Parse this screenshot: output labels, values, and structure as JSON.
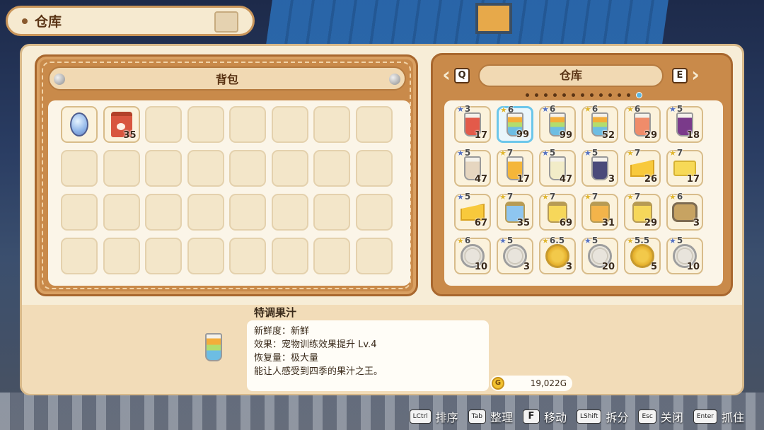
{
  "window": {
    "title": "仓库"
  },
  "backpack": {
    "title": "背包",
    "slots": [
      {
        "icon": "mirror-icon",
        "qty": ""
      },
      {
        "icon": "pet-food-bag-icon",
        "qty": "35"
      },
      {},
      {},
      {},
      {},
      {},
      {},
      {},
      {},
      {},
      {},
      {},
      {},
      {},
      {},
      {},
      {},
      {},
      {},
      {},
      {},
      {},
      {},
      {},
      {},
      {},
      {},
      {},
      {},
      {},
      {}
    ]
  },
  "storage": {
    "title": "仓库",
    "prev_key": "Q",
    "next_key": "E",
    "prev_arrow": "‹",
    "next_arrow": "›",
    "page_count": 13,
    "active_page": 12,
    "items": [
      {
        "icon": "strawberry-juice-icon",
        "stars": "3",
        "star_color": "#5470c0",
        "qty": "17",
        "fill": "#e35a4a"
      },
      {
        "icon": "special-juice-icon",
        "stars": "6",
        "star_color": "#e0b52c",
        "qty": "99",
        "fill": "#7dc6e8",
        "selected": true
      },
      {
        "icon": "special-juice-icon",
        "stars": "6",
        "star_color": "#5470c0",
        "qty": "99",
        "fill": "#7dc6e8"
      },
      {
        "icon": "special-juice-icon",
        "stars": "6",
        "star_color": "#e0b52c",
        "qty": "52",
        "fill": "#7dc6e8"
      },
      {
        "icon": "peach-juice-icon",
        "stars": "6",
        "star_color": "#e0b52c",
        "qty": "29",
        "fill": "#f08c6a"
      },
      {
        "icon": "grape-juice-icon",
        "stars": "5",
        "star_color": "#5470c0",
        "qty": "18",
        "fill": "#7a3a8a"
      },
      {
        "icon": "coffee-milk-icon",
        "stars": "5",
        "star_color": "#5470c0",
        "qty": "47",
        "fill": "#e6d6c0"
      },
      {
        "icon": "orange-juice-icon",
        "stars": "7",
        "star_color": "#e0b52c",
        "qty": "17",
        "fill": "#f4b63a"
      },
      {
        "icon": "milk-icon",
        "stars": "5",
        "star_color": "#5470c0",
        "qty": "47",
        "fill": "#f2ecc8"
      },
      {
        "icon": "blueberry-juice-icon",
        "stars": "5",
        "star_color": "#5470c0",
        "qty": "3",
        "fill": "#4a4a7a"
      },
      {
        "icon": "cheese-icon",
        "stars": "7",
        "star_color": "#e0b52c",
        "qty": "26",
        "fill": ""
      },
      {
        "icon": "butter-icon",
        "stars": "7",
        "star_color": "#e0b52c",
        "qty": "17",
        "fill": ""
      },
      {
        "icon": "cheese-icon",
        "stars": "5",
        "star_color": "#5470c0",
        "qty": "67",
        "fill": ""
      },
      {
        "icon": "yogurt-jar-icon",
        "stars": "7",
        "star_color": "#e0b52c",
        "qty": "35",
        "fill": "#8ec6f0"
      },
      {
        "icon": "honey-jar-icon",
        "stars": "7",
        "star_color": "#e0b52c",
        "qty": "69",
        "fill": "#f6d75a"
      },
      {
        "icon": "honey-jar-icon",
        "stars": "7",
        "star_color": "#e0b52c",
        "qty": "31",
        "fill": "#f3b44a"
      },
      {
        "icon": "honey-jar-icon",
        "stars": "7",
        "star_color": "#e0b52c",
        "qty": "29",
        "fill": "#f6d75a"
      },
      {
        "icon": "belt-icon",
        "stars": "6",
        "star_color": "#e0b52c",
        "qty": "3",
        "fill": ""
      },
      {
        "icon": "plate-icon",
        "stars": "6",
        "star_color": "#e0b52c",
        "qty": "10",
        "fill": ""
      },
      {
        "icon": "plate-icon",
        "stars": "5",
        "star_color": "#5470c0",
        "qty": "3",
        "fill": ""
      },
      {
        "icon": "gold-plate-icon",
        "stars": "6.5",
        "star_color": "#e0b52c",
        "qty": "3",
        "fill": ""
      },
      {
        "icon": "plate-icon",
        "stars": "5",
        "star_color": "#5470c0",
        "qty": "20",
        "fill": ""
      },
      {
        "icon": "gold-plate-icon",
        "stars": "5.5",
        "star_color": "#e0b52c",
        "qty": "5",
        "fill": ""
      },
      {
        "icon": "plate-icon",
        "stars": "5",
        "star_color": "#5470c0",
        "qty": "10",
        "fill": ""
      }
    ]
  },
  "item_info": {
    "name": "特调果汁",
    "icon": "special-juice-icon",
    "lines": [
      "新鲜度：新鲜",
      "效果：宠物训练效果提升 Lv.4",
      "恢复量：极大量",
      "能让人感受到四季的果汁之王。"
    ]
  },
  "gold": {
    "coin_label": "G",
    "amount": "19,022G"
  },
  "hints": [
    {
      "key": "LCtrl",
      "label": "排序"
    },
    {
      "key": "Tab",
      "label": "整理"
    },
    {
      "key": "F",
      "label": "移动",
      "big": true
    },
    {
      "key": "LShift",
      "label": "拆分"
    },
    {
      "key": "Esc",
      "label": "关闭"
    },
    {
      "key": "Enter",
      "label": "抓住"
    }
  ]
}
